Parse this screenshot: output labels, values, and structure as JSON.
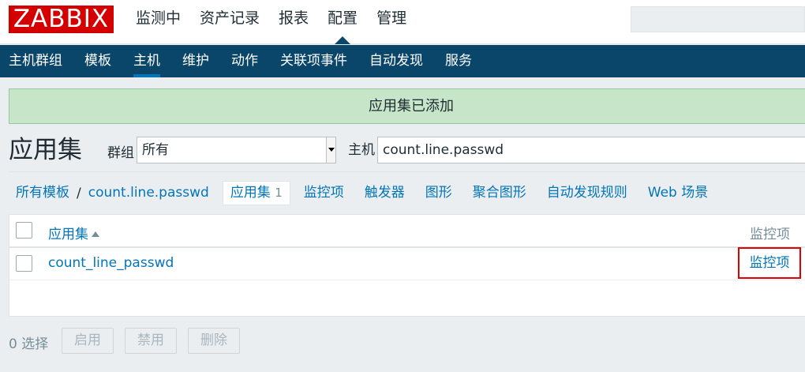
{
  "header": {
    "logo": "ZABBIX",
    "menu": [
      "监测中",
      "资产记录",
      "报表",
      "配置",
      "管理"
    ],
    "active_menu": "配置"
  },
  "submenu": {
    "items": [
      "主机群组",
      "模板",
      "主机",
      "维护",
      "动作",
      "关联项事件",
      "自动发现",
      "服务"
    ],
    "active": "主机"
  },
  "message": "应用集已添加",
  "page": {
    "title": "应用集",
    "group_label": "群组",
    "group_value": "所有",
    "host_label": "主机",
    "host_value": "count.line.passwd"
  },
  "breadcrumbs": {
    "all_templates": "所有模板",
    "separator": "/",
    "template": "count.line.passwd",
    "tabs": {
      "applications": "应用集",
      "applications_count": "1",
      "items": "监控项",
      "triggers": "触发器",
      "graphs": "图形",
      "screens": "聚合图形",
      "discovery": "自动发现规则",
      "web": "Web 场景"
    }
  },
  "table": {
    "header_name": "应用集",
    "header_items": "监控项",
    "rows": [
      {
        "name": "count_line_passwd",
        "items": "监控项"
      }
    ]
  },
  "footer": {
    "selected": "0 选择",
    "buttons": [
      "启用",
      "禁用",
      "删除"
    ]
  }
}
